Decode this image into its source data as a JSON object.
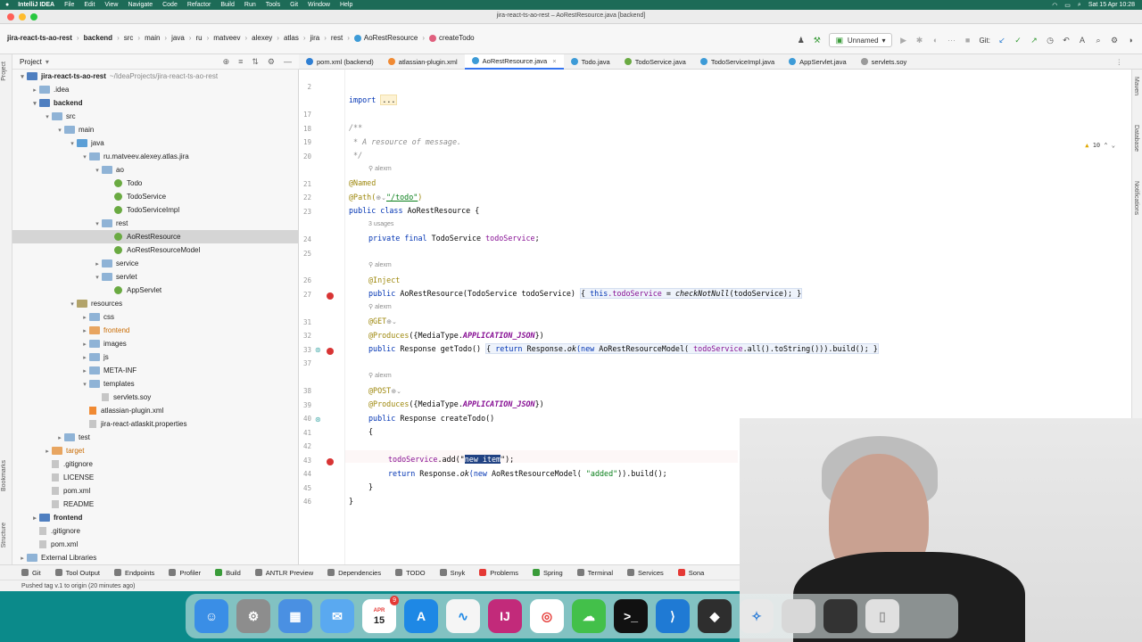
{
  "menubar": {
    "app": "IntelliJ IDEA",
    "items": [
      "File",
      "Edit",
      "View",
      "Navigate",
      "Code",
      "Refactor",
      "Build",
      "Run",
      "Tools",
      "Git",
      "Window",
      "Help"
    ],
    "clock": "Sat 15 Apr 10:28"
  },
  "window": {
    "title": "jira-react-ts-ao-rest – AoRestResource.java [backend]"
  },
  "breadcrumb": [
    "jira-react-ts-ao-rest",
    "backend",
    "src",
    "main",
    "java",
    "ru",
    "matveev",
    "alexey",
    "atlas",
    "jira",
    "rest",
    "AoRestResource",
    "createTodo"
  ],
  "toolbar": {
    "run_config": "Unnamed",
    "git_label": "Git:"
  },
  "project_panel": {
    "title": "Project",
    "tree": [
      {
        "label": "jira-react-ts-ao-rest",
        "suffix": "~/IdeaProjects/jira-react-ts-ao-rest",
        "depth": 0,
        "arrow": "▾",
        "icon": "mod",
        "bold": true
      },
      {
        "label": ".idea",
        "depth": 1,
        "arrow": "▸",
        "icon": "folder"
      },
      {
        "label": "backend",
        "depth": 1,
        "arrow": "▾",
        "icon": "mod",
        "bold": true
      },
      {
        "label": "src",
        "depth": 2,
        "arrow": "▾",
        "icon": "folder"
      },
      {
        "label": "main",
        "depth": 3,
        "arrow": "▾",
        "icon": "folder"
      },
      {
        "label": "java",
        "depth": 4,
        "arrow": "▾",
        "icon": "folder-src"
      },
      {
        "label": "ru.matveev.alexey.atlas.jira",
        "depth": 5,
        "arrow": "▾",
        "icon": "folder"
      },
      {
        "label": "ao",
        "depth": 6,
        "arrow": "▾",
        "icon": "folder"
      },
      {
        "label": "Todo",
        "depth": 7,
        "arrow": "",
        "icon": "cls"
      },
      {
        "label": "TodoService",
        "depth": 7,
        "arrow": "",
        "icon": "cls"
      },
      {
        "label": "TodoServiceImpl",
        "depth": 7,
        "arrow": "",
        "icon": "cls"
      },
      {
        "label": "rest",
        "depth": 6,
        "arrow": "▾",
        "icon": "folder"
      },
      {
        "label": "AoRestResource",
        "depth": 7,
        "arrow": "",
        "icon": "cls",
        "selected": true
      },
      {
        "label": "AoRestResourceModel",
        "depth": 7,
        "arrow": "",
        "icon": "cls"
      },
      {
        "label": "service",
        "depth": 6,
        "arrow": "▸",
        "icon": "folder"
      },
      {
        "label": "servlet",
        "depth": 6,
        "arrow": "▾",
        "icon": "folder"
      },
      {
        "label": "AppServlet",
        "depth": 7,
        "arrow": "",
        "icon": "cls"
      },
      {
        "label": "resources",
        "depth": 4,
        "arrow": "▾",
        "icon": "folder-res"
      },
      {
        "label": "css",
        "depth": 5,
        "arrow": "▸",
        "icon": "folder"
      },
      {
        "label": "frontend",
        "depth": 5,
        "arrow": "▸",
        "icon": "folder-o",
        "orange": true
      },
      {
        "label": "images",
        "depth": 5,
        "arrow": "▸",
        "icon": "folder"
      },
      {
        "label": "js",
        "depth": 5,
        "arrow": "▸",
        "icon": "folder"
      },
      {
        "label": "META-INF",
        "depth": 5,
        "arrow": "▸",
        "icon": "folder"
      },
      {
        "label": "templates",
        "depth": 5,
        "arrow": "▾",
        "icon": "folder"
      },
      {
        "label": "servlets.soy",
        "depth": 6,
        "arrow": "",
        "icon": "file"
      },
      {
        "label": "atlassian-plugin.xml",
        "depth": 5,
        "arrow": "",
        "icon": "xml"
      },
      {
        "label": "jira-react-atlaskit.properties",
        "depth": 5,
        "arrow": "",
        "icon": "file"
      },
      {
        "label": "test",
        "depth": 3,
        "arrow": "▸",
        "icon": "folder"
      },
      {
        "label": "target",
        "depth": 2,
        "arrow": "▸",
        "icon": "folder-o",
        "orange": true
      },
      {
        "label": ".gitignore",
        "depth": 2,
        "arrow": "",
        "icon": "file"
      },
      {
        "label": "LICENSE",
        "depth": 2,
        "arrow": "",
        "icon": "file"
      },
      {
        "label": "pom.xml",
        "depth": 2,
        "arrow": "",
        "icon": "file"
      },
      {
        "label": "README",
        "depth": 2,
        "arrow": "",
        "icon": "file"
      },
      {
        "label": "frontend",
        "depth": 1,
        "arrow": "▸",
        "icon": "mod",
        "bold": true
      },
      {
        "label": ".gitignore",
        "depth": 1,
        "arrow": "",
        "icon": "file"
      },
      {
        "label": "pom.xml",
        "depth": 1,
        "arrow": "",
        "icon": "file"
      },
      {
        "label": "External Libraries",
        "depth": 0,
        "arrow": "▸",
        "icon": "folder"
      }
    ]
  },
  "tabs": [
    {
      "label": "pom.xml (backend)",
      "color": "#2f7fd3"
    },
    {
      "label": "atlassian-plugin.xml",
      "color": "#f08a33"
    },
    {
      "label": "AoRestResource.java",
      "color": "#3d9bd7",
      "active": true
    },
    {
      "label": "Todo.java",
      "color": "#3d9bd7"
    },
    {
      "label": "TodoService.java",
      "color": "#6aaa42"
    },
    {
      "label": "TodoServiceImpl.java",
      "color": "#3d9bd7"
    },
    {
      "label": "AppServlet.java",
      "color": "#3d9bd7"
    },
    {
      "label": "servlets.soy",
      "color": "#9a9a9a"
    }
  ],
  "editor": {
    "warnings": "10",
    "line_numbers": [
      "2",
      "17",
      "18",
      "19",
      "20",
      "21",
      "22",
      "23",
      "24",
      "25",
      "26",
      "27",
      "31",
      "32",
      "33",
      "37",
      "38",
      "39",
      "40",
      "41",
      "42",
      "43",
      "44",
      "45",
      "46"
    ],
    "hints": {
      "alexm": "alexm",
      "usages": "3 usages"
    },
    "code": {
      "import_kw": "import",
      "import_fold": "...",
      "javadoc_open": "/**",
      "javadoc_text": " * A resource of message.",
      "javadoc_close": " */",
      "named": "@Named",
      "path_ann": "@Path(",
      "path_str": "\"/todo\"",
      "path_close": ")",
      "class_kw": "public class",
      "class_name": "AoRestResource {",
      "field_kw": "private final",
      "field_type": "TodoService",
      "field_name": "todoService",
      "field_end": ";",
      "inject": "@Inject",
      "ctor_kw": "public",
      "ctor_sig": "AoRestResource(TodoService todoService)",
      "ctor_body_open": "{ ",
      "ctor_this": "this",
      "ctor_field": ".todoService",
      "ctor_assign": " = ",
      "ctor_call": "checkNotNull",
      "ctor_args": "(todoService); }",
      "get_ann": "@GET",
      "produces_ann": "@Produces",
      "produces_open": "({MediaType.",
      "produces_const": "APPLICATION_JSON",
      "produces_close": "})",
      "get_sig_kw": "public",
      "get_sig": "Response getTodo()",
      "get_body_open": "{ ",
      "get_return": "return",
      "get_resp": " Response.",
      "get_ok": "ok",
      "get_new": "(new",
      "get_model": " AoRestResourceModel( ",
      "get_field": "todoService",
      "get_tail": ".all().toString())).build(); }",
      "post_ann": "@POST",
      "create_kw": "public",
      "create_sig": "Response createTodo()",
      "brace_open": "{",
      "add_field": "todoService",
      "add_call": ".add(\"",
      "add_selected": "new item",
      "add_end": "\");",
      "ret_kw": "return",
      "ret_resp": " Response.",
      "ret_ok": "ok",
      "ret_new": "(new",
      "ret_model": " AoRestResourceModel( ",
      "ret_str": "\"added\"",
      "ret_end": ")).build();",
      "brace_close_method": "}",
      "brace_close_class": "}"
    }
  },
  "bottom_tools": [
    "Git",
    "Tool Output",
    "Endpoints",
    "Profiler",
    "Build",
    "ANTLR Preview",
    "Dependencies",
    "TODO",
    "Snyk",
    "Problems",
    "Spring",
    "Terminal",
    "Services",
    "Sona"
  ],
  "status": "Pushed tag v.1 to origin (20 minutes ago)",
  "side_labels": {
    "project": "Project",
    "bookmarks": "Bookmarks",
    "structure": "Structure",
    "maven": "Maven",
    "database": "Database",
    "notifications": "Notifications"
  },
  "dock": {
    "calendar_month": "APR",
    "calendar_day": "15",
    "badge": "9"
  }
}
